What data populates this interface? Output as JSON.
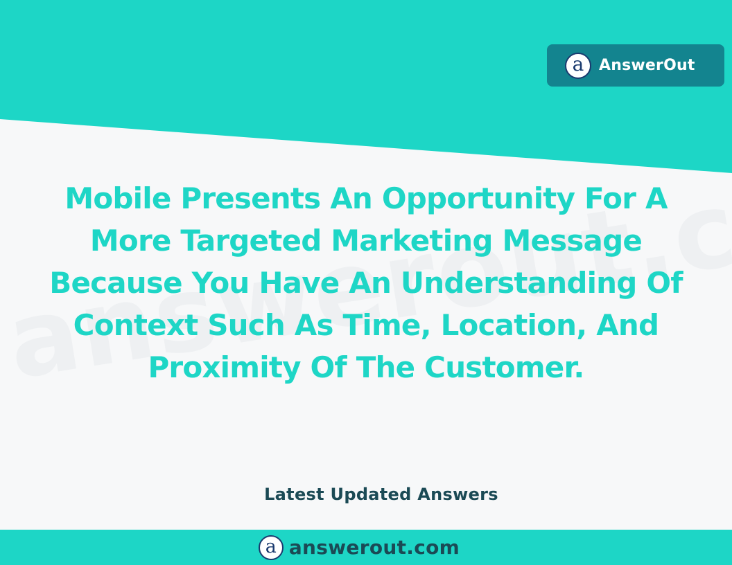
{
  "colors": {
    "teal": "#1dd6c6",
    "badge_bg": "#13848f",
    "background": "#f7f8f9",
    "dark_text": "#1b4a55",
    "logo_navy": "#1a3a6e"
  },
  "brand": {
    "logo_letter": "a",
    "name": "AnswerOut",
    "icon": "answerout-logo-icon"
  },
  "watermark": {
    "text": "answerout.com"
  },
  "headline": {
    "lines": [
      "Mobile Presents An Opportunity For A",
      "More Targeted Marketing Message",
      "Because You Have An Understanding Of",
      "Context Such As Time, Location, And",
      "Proximity Of The Customer."
    ]
  },
  "subheading": "Latest Updated Answers",
  "footer": {
    "logo_letter": "a",
    "site": "answerout.com"
  }
}
